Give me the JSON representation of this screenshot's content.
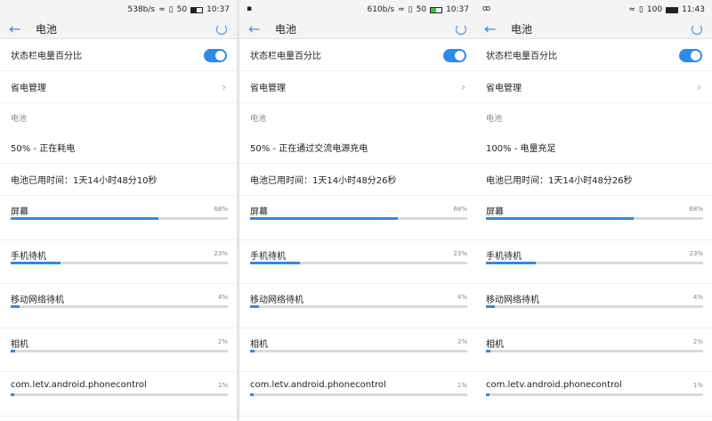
{
  "screens": [
    {
      "status": {
        "left": "",
        "speed": "538b/s",
        "battery": "50",
        "time": "10:37",
        "battery_level": 50,
        "charging": false
      },
      "title": "电池",
      "toggle_label": "状态栏电量百分比",
      "power_mgmt": "省电管理",
      "section": "电池",
      "state": "50% - 正在耗电",
      "uptime": "电池已用时间：1天14小时48分10秒"
    },
    {
      "status": {
        "left": "▪",
        "speed": "610b/s",
        "battery": "50",
        "time": "10:37",
        "battery_level": 50,
        "charging": true
      },
      "title": "电池",
      "toggle_label": "状态栏电量百分比",
      "power_mgmt": "省电管理",
      "section": "电池",
      "state": "50% - 正在通过交流电源充电",
      "uptime": "电池已用时间：1天14小时48分26秒"
    },
    {
      "status": {
        "left": "ꝏ",
        "speed": "",
        "battery": "100",
        "time": "11:43",
        "battery_level": 100,
        "charging": false
      },
      "title": "电池",
      "toggle_label": "状态栏电量百分比",
      "power_mgmt": "省电管理",
      "section": "电池",
      "state": "100% - 电量充足",
      "uptime": "电池已用时间：1天14小时48分26秒"
    }
  ],
  "usage": [
    {
      "name": "屏幕",
      "pct": "68%",
      "value": 68
    },
    {
      "name": "手机待机",
      "pct": "23%",
      "value": 23
    },
    {
      "name": "移动网络待机",
      "pct": "4%",
      "value": 4
    },
    {
      "name": "相机",
      "pct": "2%",
      "value": 2
    },
    {
      "name": "com.letv.android.phonecontrol",
      "pct": "1%",
      "value": 1
    }
  ],
  "colors": {
    "accent": "#2f8ae5",
    "charging": "#3bc23b"
  }
}
